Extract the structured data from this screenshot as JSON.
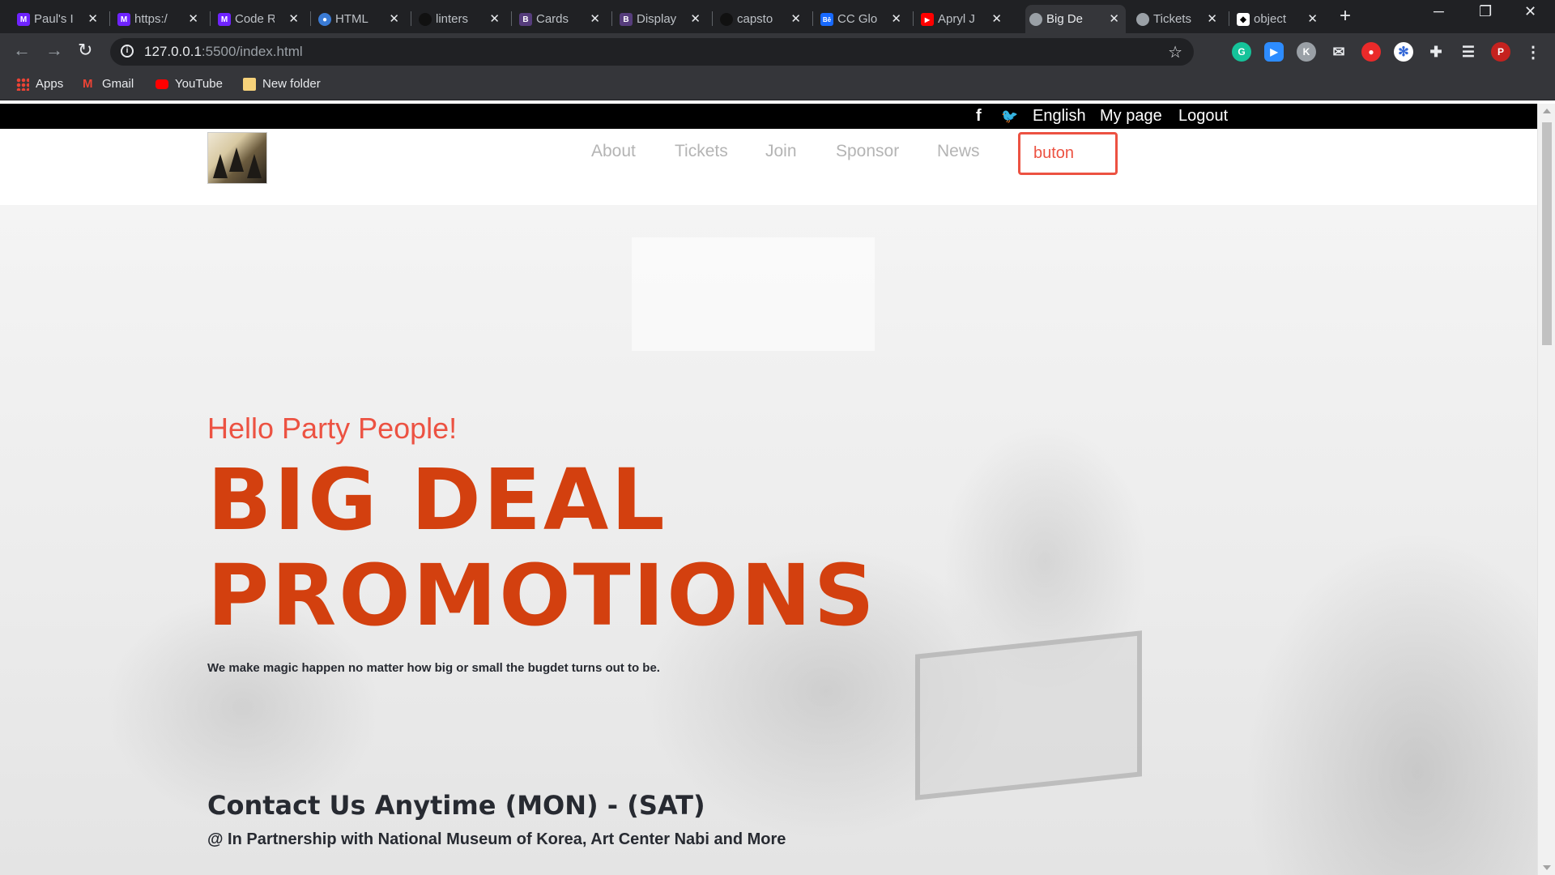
{
  "browser": {
    "tabs": [
      {
        "label": "Paul's I",
        "favicon": "microverse-icon",
        "color": "#6f23ff"
      },
      {
        "label": "https:/",
        "favicon": "microverse-icon",
        "color": "#6f23ff"
      },
      {
        "label": "Code R",
        "favicon": "microverse-icon",
        "color": "#6f23ff"
      },
      {
        "label": "HTML",
        "favicon": "chat-icon",
        "color": "#3a7bd5"
      },
      {
        "label": "linters",
        "favicon": "github-icon",
        "color": "#000000"
      },
      {
        "label": "Cards",
        "favicon": "bootstrap-icon",
        "color": "#563d7c"
      },
      {
        "label": "Display",
        "favicon": "bootstrap-icon",
        "color": "#563d7c"
      },
      {
        "label": "capsto",
        "favicon": "github-icon",
        "color": "#000000"
      },
      {
        "label": "CC Glo",
        "favicon": "behance-icon",
        "color": "#1769ff"
      },
      {
        "label": "Apryl J",
        "favicon": "youtube-icon",
        "color": "#ff0000"
      },
      {
        "label": "Big De",
        "favicon": "globe-icon",
        "color": "#9aa0a6"
      },
      {
        "label": "Tickets",
        "favicon": "globe-icon",
        "color": "#9aa0a6"
      },
      {
        "label": "object",
        "favicon": "codepen-icon",
        "color": "#000000"
      }
    ],
    "new_tab": "+",
    "window_controls": {
      "minimize": "─",
      "restore": "❐",
      "close": "✕"
    },
    "url": {
      "host": "127.0.0.1",
      "path": ":5500/index.html"
    },
    "profile_initial": "P",
    "extension_initial": "K",
    "bookmarks": [
      {
        "label": "Apps",
        "icon": "apps-grid-icon"
      },
      {
        "label": "Gmail",
        "icon": "gmail-icon"
      },
      {
        "label": "YouTube",
        "icon": "youtube-icon"
      },
      {
        "label": "New folder",
        "icon": "folder-icon"
      }
    ]
  },
  "page": {
    "topbar": {
      "social": [
        "f",
        "🐦"
      ],
      "links": [
        "English",
        "My page",
        "Logout"
      ]
    },
    "nav": {
      "items": [
        "About",
        "Tickets",
        "Join",
        "Sponsor",
        "News"
      ],
      "button_label": "buton"
    },
    "hero": {
      "greeting": "Hello Party People!",
      "title_line1": "BIG DEAL",
      "title_line2": "PROMOTIONS",
      "tagline": "We make magic happen no matter how big or small the bugdet turns out to be.",
      "contact": "Contact Us Anytime (MON) - (SAT)",
      "partner": "@ In Partnership with National Museum of Korea, Art Center Nabi and More"
    },
    "colors": {
      "accent": "#ec5242",
      "title": "#d3400f",
      "text": "#272a31"
    }
  }
}
